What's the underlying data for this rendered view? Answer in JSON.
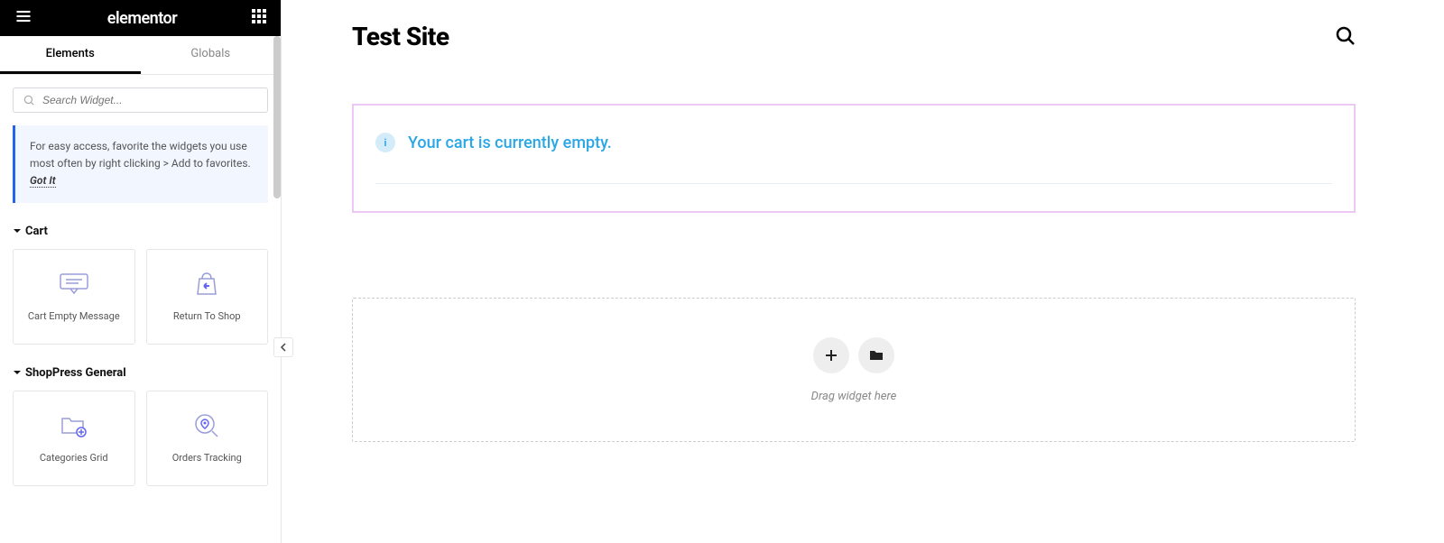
{
  "header": {
    "logo": "elementor"
  },
  "tabs": {
    "elements": "Elements",
    "globals": "Globals"
  },
  "search": {
    "placeholder": "Search Widget..."
  },
  "tip": {
    "text": "For easy access, favorite the widgets you use most often by right clicking > Add to favorites.",
    "link": "Got It"
  },
  "categories": [
    {
      "title": "Cart",
      "widgets": [
        {
          "label": "Cart Empty Message",
          "icon": "chat"
        },
        {
          "label": "Return To Shop",
          "icon": "bag-back"
        }
      ]
    },
    {
      "title": "ShopPress General",
      "widgets": [
        {
          "label": "Categories Grid",
          "icon": "folder-grid"
        },
        {
          "label": "Orders Tracking",
          "icon": "search-pin"
        }
      ]
    }
  ],
  "canvas": {
    "site_title": "Test Site",
    "notice_text": "Your cart is currently empty.",
    "drop_hint": "Drag widget here"
  }
}
